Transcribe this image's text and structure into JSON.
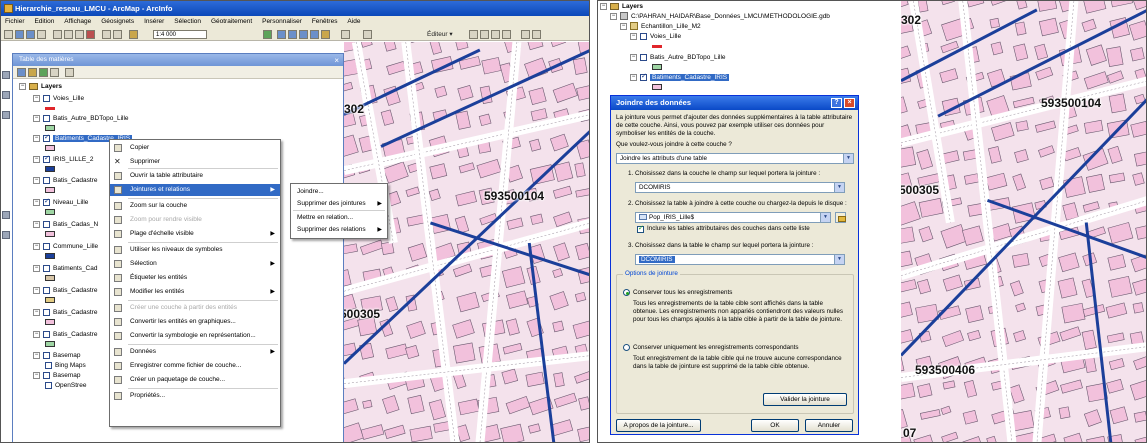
{
  "arcmap": {
    "title": "Hierarchie_reseau_LMCU - ArcMap - ArcInfo",
    "menu": [
      "Fichier",
      "Edition",
      "Affichage",
      "Géosignets",
      "Insérer",
      "Sélection",
      "Géotraitement",
      "Personnaliser",
      "Fenêtres",
      "Aide"
    ],
    "scale": "1:4 000",
    "editor_label": "Éditeur ▾"
  },
  "toc": {
    "title": "Table des matières",
    "root": "Layers",
    "layers": [
      {
        "name": "Voies_Lille",
        "checked": false,
        "swatch": "#e0262b"
      },
      {
        "name": "Batis_Autre_BDTopo_Lille",
        "checked": false,
        "swatch": "#9fd6a4"
      },
      {
        "name": "Batiments_Cadastre_IRIS",
        "checked": true,
        "swatch": "#f2c1dc"
      },
      {
        "name": "IRIS_LILLE_2",
        "checked": true,
        "swatch": "#1b3f9a"
      },
      {
        "name": "Batis_Cadastre",
        "checked": false,
        "swatch": "#f2c1dc"
      },
      {
        "name": "Niveau_Lille",
        "checked": true,
        "swatch": "#9fd6a4"
      },
      {
        "name": "Batis_Cadas_N",
        "checked": false,
        "swatch": "#f2c1dc"
      },
      {
        "name": "Commune_Lille",
        "checked": false,
        "swatch": "#1b3f9a"
      },
      {
        "name": "Batiments_Cad",
        "checked": false,
        "swatch": "#d8c6a8"
      },
      {
        "name": "Batis_Cadastre",
        "checked": false,
        "swatch": "#e3cc84"
      },
      {
        "name": "Batis_Cadastre",
        "checked": false,
        "swatch": "#f2c1dc"
      },
      {
        "name": "Batis_Cadastre",
        "checked": false,
        "swatch": "#9fd6a4"
      },
      {
        "name": "Basemap",
        "checked": false,
        "swatch": ""
      },
      {
        "name": "Bing Maps",
        "checked": false,
        "swatch": ""
      },
      {
        "name": "Basemap",
        "checked": false,
        "swatch": ""
      },
      {
        "name": "OpenStree",
        "checked": false,
        "swatch": ""
      }
    ]
  },
  "context_menu": {
    "items": [
      {
        "label": "Copier",
        "disabled": false,
        "submenu": false,
        "highlight": false
      },
      {
        "label": "Supprimer",
        "disabled": false,
        "submenu": false,
        "highlight": false
      },
      {
        "label": "Ouvrir la table attributaire",
        "disabled": false,
        "submenu": false,
        "highlight": false
      },
      {
        "label": "Jointures et relations",
        "disabled": false,
        "submenu": true,
        "highlight": true
      },
      {
        "label": "Zoom sur la couche",
        "disabled": false,
        "submenu": false,
        "highlight": false
      },
      {
        "label": "Zoom pour rendre visible",
        "disabled": true,
        "submenu": false,
        "highlight": false
      },
      {
        "label": "Plage d'échelle visible",
        "disabled": false,
        "submenu": true,
        "highlight": false
      },
      {
        "label": "Utiliser les niveaux de symboles",
        "disabled": false,
        "submenu": false,
        "highlight": false
      },
      {
        "label": "Sélection",
        "disabled": false,
        "submenu": true,
        "highlight": false
      },
      {
        "label": "Étiqueter les entités",
        "disabled": false,
        "submenu": false,
        "highlight": false
      },
      {
        "label": "Modifier les entités",
        "disabled": false,
        "submenu": true,
        "highlight": false
      },
      {
        "label": "Créer une couche à partir des entités",
        "disabled": true,
        "submenu": false,
        "highlight": false
      },
      {
        "label": "Convertir les entités en graphiques...",
        "disabled": false,
        "submenu": false,
        "highlight": false
      },
      {
        "label": "Convertir la symbologie en représentation...",
        "disabled": false,
        "submenu": false,
        "highlight": false
      },
      {
        "label": "Données",
        "disabled": false,
        "submenu": true,
        "highlight": false
      },
      {
        "label": "Enregistrer comme fichier de couche...",
        "disabled": false,
        "submenu": false,
        "highlight": false
      },
      {
        "label": "Créer un paquetage de couche...",
        "disabled": false,
        "submenu": false,
        "highlight": false
      },
      {
        "label": "Propriétés...",
        "disabled": false,
        "submenu": false,
        "highlight": false
      }
    ]
  },
  "submenu": {
    "items": [
      {
        "label": "Joindre...",
        "submenu": false
      },
      {
        "label": "Supprimer des jointures",
        "submenu": true
      },
      {
        "label": "Mettre en relation...",
        "submenu": false
      },
      {
        "label": "Supprimer des relations",
        "submenu": true
      }
    ]
  },
  "map_left": {
    "labels": [
      "302",
      "593500104",
      "500305"
    ]
  },
  "map_right": {
    "labels": [
      "302",
      "593500104",
      "500305",
      "593500406",
      "07"
    ]
  },
  "catalog": {
    "root": "Layers",
    "path": "C:\\PAHRAN_HAIDAR\\Base_Données_LMCU\\METHODOLOGIE.gdb",
    "dataset": "Echantillon_Lille_M2",
    "layers": [
      {
        "name": "Voies_Lille",
        "checked": false,
        "swatch": "#e0262b"
      },
      {
        "name": "Batis_Autre_BDTopo_Lille",
        "checked": false,
        "swatch": "#9fd6a4"
      },
      {
        "name": "Batiments_Cadastre_IRIS",
        "checked": true,
        "swatch": "#f2c1dc"
      }
    ]
  },
  "dialog": {
    "title": "Joindre des données",
    "intro": "La jointure vous permet d'ajouter des données supplémentaires à la table attributaire de cette couche. Ainsi, vous pouvez par exemple utiliser ces données pour symboliser les entités de la couche.",
    "question": "Que voulez-vous joindre à cette couche ?",
    "join_type": "Joindre les attributs d'une table",
    "step1_label": "1.  Choisissez dans la couche le champ sur lequel portera la jointure :",
    "step1_value": "DCOMIRIS",
    "step2_label": "2.  Choisissez la table à joindre à cette couche ou chargez-la depuis le disque :",
    "step2_value": "Pop_IRIS_Lille$",
    "include_label": "Inclure les tables attributaires des couches dans cette liste",
    "include_checked": true,
    "step3_label": "3.  Choisissez dans la table le champ sur lequel portera la jointure :",
    "step3_value": "DCOMIRIS",
    "options_legend": "Options de jointure",
    "opt1_label": "Conserver tous les enregistrements",
    "opt1_desc": "Tous les enregistrements de la table cible sont affichés dans la table obtenue. Les enregistrements non appariés contiendront des valeurs nulles pour tous les champs ajoutés à la table cible à partir de la table de jointure.",
    "opt1_selected": true,
    "opt2_label": "Conserver uniquement les enregistrements correspondants",
    "opt2_desc": "Tout enregistrement de la table cible qui ne trouve aucune correspondance dans la table de jointure est supprimé de la table cible obtenue.",
    "validate_button": "Valider la jointure",
    "about_button": "A propos de la jointure...",
    "ok_button": "OK",
    "cancel_button": "Annuler"
  },
  "colors": {
    "building_fill": "#f2c1dc",
    "building_stroke": "#6b5a70",
    "street_fill": "#ffffff",
    "iris_boundary": "#1b3f9a",
    "selection_blue": "#316ac5",
    "xp_title_blue": "#0a49c7"
  }
}
